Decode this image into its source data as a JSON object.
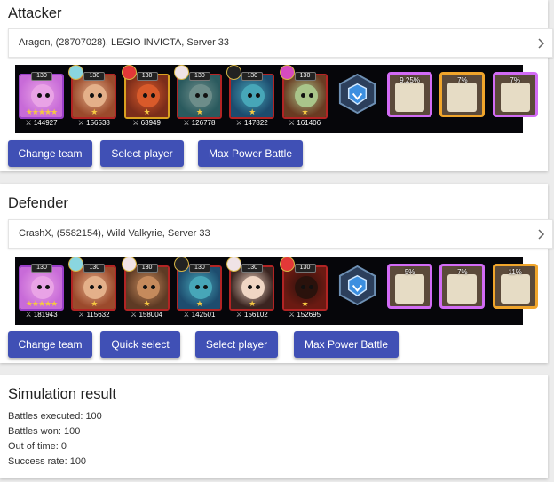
{
  "attacker": {
    "title": "Attacker",
    "selector_text": "Aragon, (28707028), LEGIO INVICTA, Server 33",
    "heroes": [
      {
        "level": "130",
        "power": "144927",
        "colors": {
          "bg": "#c86bd8",
          "face": "#e9a3e6",
          "frame": "purple"
        },
        "stars": "★★★★★",
        "pet": false
      },
      {
        "level": "130",
        "power": "156538",
        "colors": {
          "bg": "#9b4a2c",
          "face": "#e4b08a",
          "frame": "red"
        },
        "stars": "★",
        "pet": true,
        "pet_color": "#8ad6e0"
      },
      {
        "level": "130",
        "power": "63949",
        "colors": {
          "bg": "#7b2d1a",
          "face": "#d95a2a",
          "frame": "gold"
        },
        "stars": "★",
        "pet": true,
        "pet_color": "#e23838"
      },
      {
        "level": "130",
        "power": "126778",
        "colors": {
          "bg": "#2a5a5e",
          "face": "#6d8d8a",
          "frame": "red"
        },
        "stars": "★",
        "pet": true,
        "pet_color": "#f0e3e6"
      },
      {
        "level": "130",
        "power": "147822",
        "colors": {
          "bg": "#1d4c6e",
          "face": "#47a6b8",
          "frame": "red"
        },
        "stars": "★",
        "pet": true,
        "pet_color": "#222"
      },
      {
        "level": "130",
        "power": "161406",
        "colors": {
          "bg": "#6a3b22",
          "face": "#a9c58a",
          "frame": "red"
        },
        "stars": "★",
        "pet": true,
        "pet_color": "#d64bbf"
      }
    ],
    "banner_icon": "shield-banner-icon",
    "patrons": [
      {
        "pct": "9.25%",
        "frame": "purple"
      },
      {
        "pct": "7%",
        "frame": "gold"
      },
      {
        "pct": "7%",
        "frame": "purple"
      }
    ],
    "buttons": {
      "change_team": "Change team",
      "select_player": "Select player",
      "max_power": "Max Power Battle"
    }
  },
  "defender": {
    "title": "Defender",
    "selector_text": "CrashX, (5582154), Wild Valkyrie, Server 33",
    "heroes": [
      {
        "level": "130",
        "power": "181943",
        "colors": {
          "bg": "#c86bd8",
          "face": "#e9a3e6",
          "frame": "purple"
        },
        "stars": "★★★★★",
        "pet": false
      },
      {
        "level": "130",
        "power": "115632",
        "colors": {
          "bg": "#9b4a2c",
          "face": "#e4b08a",
          "frame": "red"
        },
        "stars": "★",
        "pet": true,
        "pet_color": "#8ad6e0"
      },
      {
        "level": "130",
        "power": "158004",
        "colors": {
          "bg": "#5e3a24",
          "face": "#c58a5c",
          "frame": "red"
        },
        "stars": "★",
        "pet": true,
        "pet_color": "#f0e3e6"
      },
      {
        "level": "130",
        "power": "142501",
        "colors": {
          "bg": "#1d4c6e",
          "face": "#47a6b8",
          "frame": "red"
        },
        "stars": "★",
        "pet": true,
        "pet_color": "#222"
      },
      {
        "level": "130",
        "power": "156102",
        "colors": {
          "bg": "#3a2420",
          "face": "#f0d6c4",
          "frame": "red"
        },
        "stars": "★",
        "pet": true,
        "pet_color": "#f0e3e6"
      },
      {
        "level": "130",
        "power": "152695",
        "colors": {
          "bg": "#6b1a12",
          "face": "#2a120c",
          "frame": "red"
        },
        "stars": "★",
        "pet": true,
        "pet_color": "#e23838"
      }
    ],
    "banner_icon": "shield-banner-icon",
    "patrons": [
      {
        "pct": "5%",
        "frame": "purple"
      },
      {
        "pct": "7%",
        "frame": "purple"
      },
      {
        "pct": "11%",
        "frame": "gold"
      }
    ],
    "buttons": {
      "change_team": "Change team",
      "quick_select": "Quick select",
      "select_player": "Select player",
      "max_power": "Max Power Battle"
    }
  },
  "result": {
    "title": "Simulation result",
    "lines": [
      "Battles executed: 100",
      "Battles won: 100",
      "Out of time: 0",
      "Success rate: 100"
    ]
  },
  "colors": {
    "accent": "#4050b5"
  }
}
